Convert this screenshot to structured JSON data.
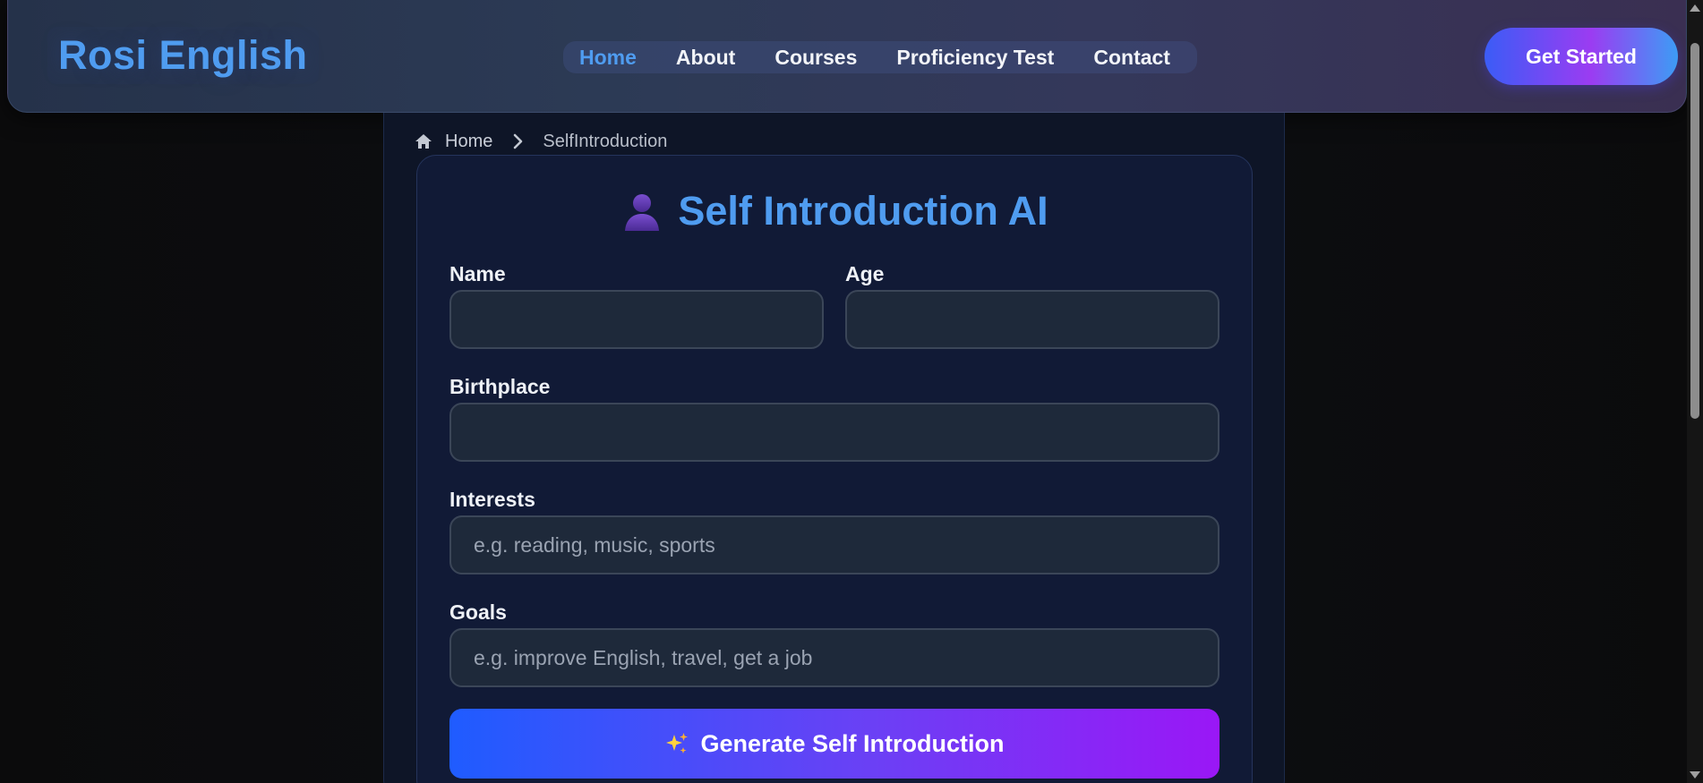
{
  "header": {
    "brand": "Rosi English",
    "nav": [
      {
        "label": "Home",
        "active": true
      },
      {
        "label": "About",
        "active": false
      },
      {
        "label": "Courses",
        "active": false
      },
      {
        "label": "Proficiency Test",
        "active": false
      },
      {
        "label": "Contact",
        "active": false
      }
    ],
    "cta_label": "Get Started"
  },
  "breadcrumb": {
    "home_icon": "home-icon",
    "home_label": "Home",
    "separator_icon": "chevron-right-icon",
    "current_label": "SelfIntroduction"
  },
  "form": {
    "title_icon": "user-silhouette-icon",
    "title": "Self Introduction AI",
    "name": {
      "label": "Name",
      "value": "",
      "placeholder": ""
    },
    "age": {
      "label": "Age",
      "value": "",
      "placeholder": ""
    },
    "birthplace": {
      "label": "Birthplace",
      "value": "",
      "placeholder": ""
    },
    "interests": {
      "label": "Interests",
      "value": "",
      "placeholder": "e.g. reading, music, sports"
    },
    "goals": {
      "label": "Goals",
      "value": "",
      "placeholder": "e.g. improve English, travel, get a job"
    },
    "submit_icon": "sparkles-icon",
    "submit_label": "Generate Self Introduction"
  },
  "colors": {
    "accent": "#4f9cf0",
    "button_gradient_start": "#1f5cff",
    "button_gradient_end": "#9a17f6"
  }
}
